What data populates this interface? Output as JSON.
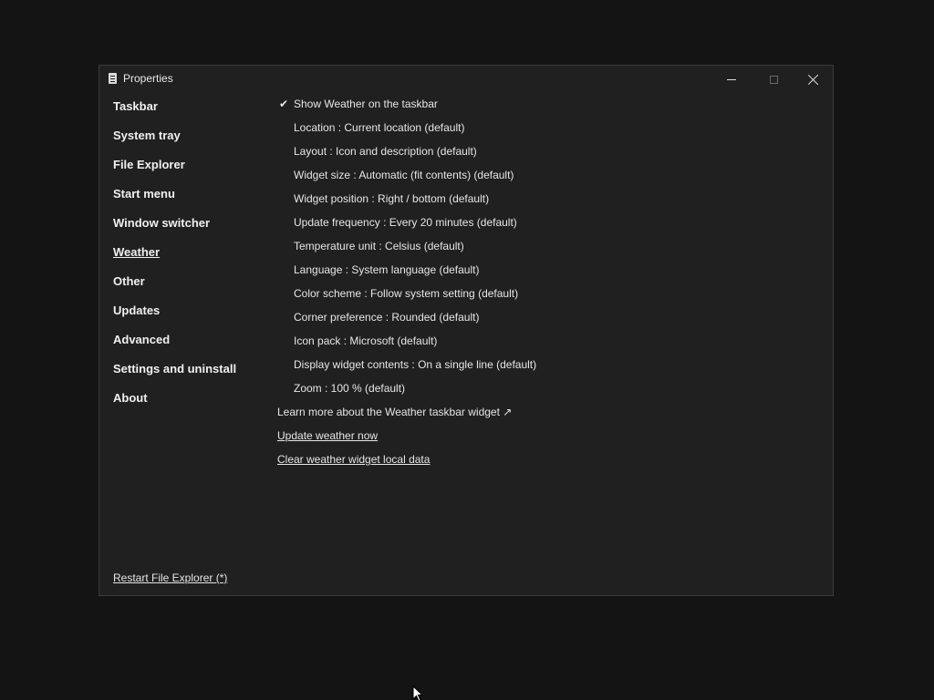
{
  "window": {
    "title": "Properties"
  },
  "nav": {
    "items": [
      {
        "label": "Taskbar"
      },
      {
        "label": "System tray"
      },
      {
        "label": "File Explorer"
      },
      {
        "label": "Start menu"
      },
      {
        "label": "Window switcher"
      },
      {
        "label": "Weather"
      },
      {
        "label": "Other"
      },
      {
        "label": "Updates"
      },
      {
        "label": "Advanced"
      },
      {
        "label": "Settings and uninstall"
      },
      {
        "label": "About"
      }
    ],
    "active": "Weather",
    "restart_label": "Restart File Explorer (*)"
  },
  "weather": {
    "show_on_taskbar": {
      "label": "Show Weather on the taskbar",
      "checked": true,
      "check_glyph": "✔"
    },
    "options": [
      {
        "label": "Location : Current location (default)"
      },
      {
        "label": "Layout : Icon and description (default)"
      },
      {
        "label": "Widget size : Automatic (fit contents) (default)"
      },
      {
        "label": "Widget position : Right / bottom (default)"
      },
      {
        "label": "Update frequency : Every 20 minutes (default)"
      },
      {
        "label": "Temperature unit : Celsius (default)"
      },
      {
        "label": "Language : System language (default)"
      },
      {
        "label": "Color scheme : Follow system setting (default)"
      },
      {
        "label": "Corner preference : Rounded (default)"
      },
      {
        "label": "Icon pack : Microsoft (default)"
      },
      {
        "label": "Display widget contents : On a single line (default)"
      },
      {
        "label": "Zoom : 100 % (default)"
      }
    ],
    "learn_more_label": "Learn more about the Weather taskbar widget ↗",
    "update_now_label": "Update weather now",
    "clear_data_label": "Clear weather widget local data"
  },
  "icons": {
    "app": "properties-icon",
    "minimize": "minimize-icon",
    "maximize": "maximize-icon",
    "close": "close-icon",
    "check": "checkmark-icon",
    "cursor": "mouse-pointer-icon"
  },
  "colors": {
    "window_bg": "#202020",
    "desktop_bg": "#141414",
    "text": "#e6e6e6"
  }
}
